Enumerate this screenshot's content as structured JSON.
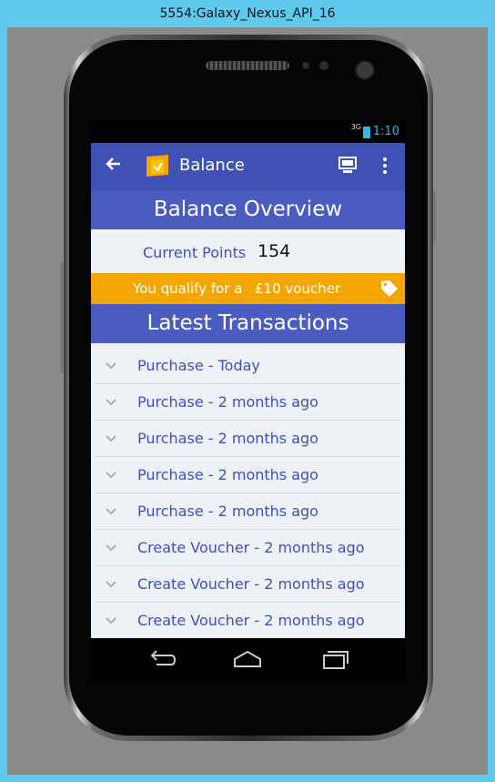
{
  "window": {
    "title": "5554:Galaxy_Nexus_API_16"
  },
  "status_bar": {
    "network": "3G",
    "time": "1:10"
  },
  "app_bar": {
    "title": "Balance",
    "back_icon": "arrow-back-icon",
    "cast_icon": "cast-icon",
    "more_icon": "more-vert-icon"
  },
  "overview": {
    "heading": "Balance Overview"
  },
  "points": {
    "label": "Current Points",
    "value": "154"
  },
  "voucher": {
    "text": "You qualify for a",
    "amount": "£10 voucher",
    "icon": "tag-icon"
  },
  "transactions": {
    "heading": "Latest Transactions",
    "items": [
      {
        "label": "Purchase - Today"
      },
      {
        "label": "Purchase - 2 months ago"
      },
      {
        "label": "Purchase - 2 months ago"
      },
      {
        "label": "Purchase - 2 months ago"
      },
      {
        "label": "Purchase - 2 months ago"
      },
      {
        "label": "Create Voucher - 2 months ago"
      },
      {
        "label": "Create Voucher - 2 months ago"
      },
      {
        "label": "Create Voucher - 2 months ago"
      }
    ]
  },
  "colors": {
    "primary": "#3f51b5",
    "accent": "#f5a700",
    "list_bg": "#eef2f7",
    "frame": "#5fcaed"
  }
}
